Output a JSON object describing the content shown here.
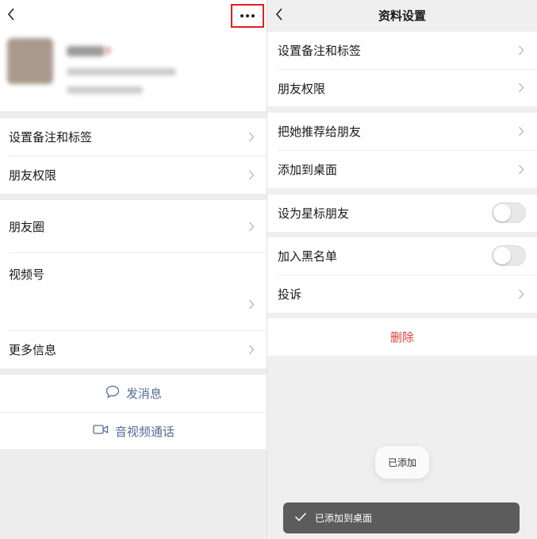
{
  "left": {
    "contact_name": "",
    "contact_detail_1": "",
    "contact_detail_2": "",
    "group1": [
      "设置备注和标签",
      "朋友权限"
    ],
    "group2": [
      "朋友圈",
      "视频号",
      "更多信息"
    ],
    "actions": {
      "message": "发消息",
      "video_call": "音视频通话"
    },
    "icons": {
      "back": "back-chevron-icon",
      "more": "more-dots-icon",
      "message": "chat-bubble-icon",
      "video": "video-camera-icon"
    }
  },
  "right": {
    "title": "资料设置",
    "group1": [
      "设置备注和标签",
      "朋友权限"
    ],
    "group2": [
      "把她推荐给朋友",
      "添加到桌面"
    ],
    "star_label": "设为星标朋友",
    "star_on": false,
    "blacklist_label": "加入黑名单",
    "blacklist_on": false,
    "complaint_label": "投诉",
    "delete_label": "删除",
    "bubble_text": "已添加",
    "toast_text": "已添加到桌面"
  },
  "colors": {
    "highlight": "#e02020",
    "link": "#576b95",
    "danger": "#e0403a"
  }
}
